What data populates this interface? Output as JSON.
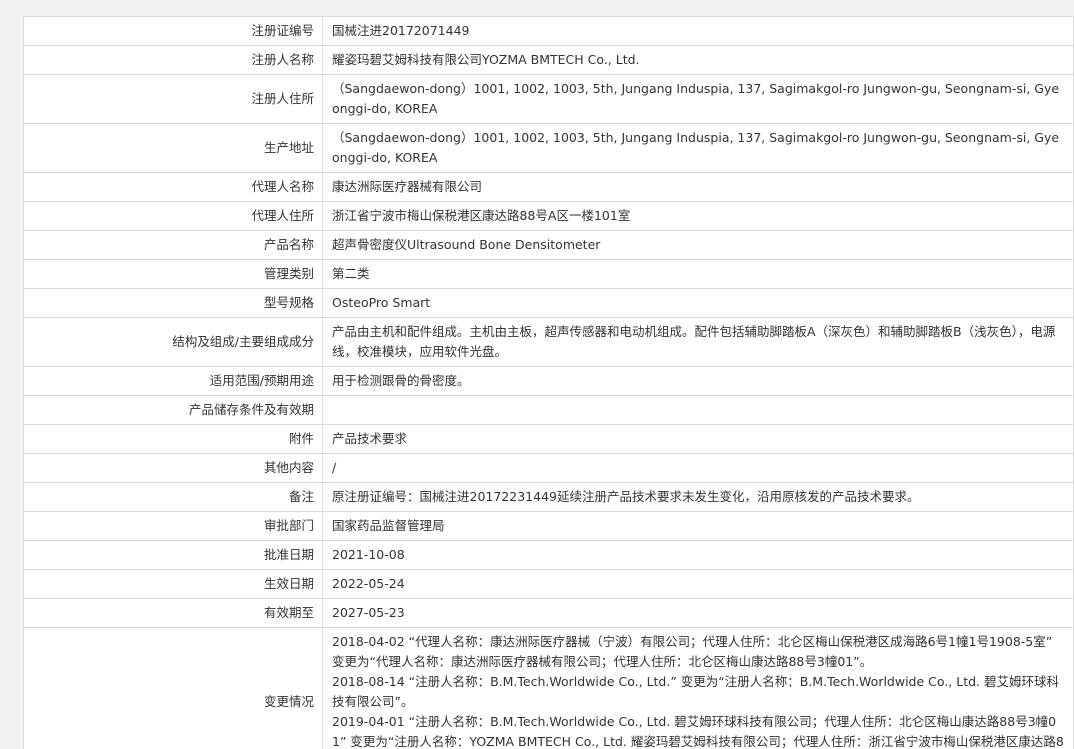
{
  "record": {
    "rows": [
      {
        "label": "注册证编号",
        "value": "国械注进20172071449"
      },
      {
        "label": "注册人名称",
        "value": "耀姿玛碧艾姆科技有限公司YOZMA BMTECH Co., Ltd."
      },
      {
        "label": "注册人住所",
        "value": "（Sangdaewon-dong）1001, 1002, 1003, 5th, Jungang Induspia, 137, Sagimakgol-ro Jungwon-gu, Seongnam-si, Gyeonggi-do, KOREA"
      },
      {
        "label": "生产地址",
        "value": "（Sangdaewon-dong）1001, 1002, 1003, 5th, Jungang Induspia, 137, Sagimakgol-ro Jungwon-gu, Seongnam-si, Gyeonggi-do, KOREA"
      },
      {
        "label": "代理人名称",
        "value": "康达洲际医疗器械有限公司"
      },
      {
        "label": "代理人住所",
        "value": "浙江省宁波市梅山保税港区康达路88号A区一楼101室"
      },
      {
        "label": "产品名称",
        "value": "超声骨密度仪Ultrasound Bone Densitometer"
      },
      {
        "label": "管理类别",
        "value": "第二类"
      },
      {
        "label": "型号规格",
        "value": "OsteoPro Smart"
      },
      {
        "label": "结构及组成/主要组成成分",
        "value": "产品由主机和配件组成。主机由主板，超声传感器和电动机组成。配件包括辅助脚踏板A（深灰色）和辅助脚踏板B（浅灰色），电源线，校准模块，应用软件光盘。"
      },
      {
        "label": "适用范围/预期用途",
        "value": "用于检测跟骨的骨密度。"
      },
      {
        "label": "产品储存条件及有效期",
        "value": ""
      },
      {
        "label": "附件",
        "value": "产品技术要求"
      },
      {
        "label": "其他内容",
        "value": "/"
      },
      {
        "label": "备注",
        "value": "原注册证编号：国械注进20172231449延续注册产品技术要求未发生变化，沿用原核发的产品技术要求。"
      },
      {
        "label": "审批部门",
        "value": "国家药品监督管理局"
      },
      {
        "label": "批准日期",
        "value": "2021-10-08"
      },
      {
        "label": "生效日期",
        "value": "2022-05-24"
      },
      {
        "label": "有效期至",
        "value": "2027-05-23"
      }
    ],
    "history": {
      "label": "变更情况",
      "lines": [
        "2018-04-02 “代理人名称：康达洲际医疗器械（宁波）有限公司；代理人住所：北仑区梅山保税港区成海路6号1幢1号1908-5室” 变更为“代理人名称：康达洲际医疗器械有限公司；代理人住所：北仑区梅山康达路88号3幢01”。",
        "2018-08-14 “注册人名称：B.M.Tech.Worldwide Co., Ltd.” 变更为“注册人名称：B.M.Tech.Worldwide Co., Ltd. 碧艾姆环球科技有限公司”。",
        "2019-04-01 “注册人名称：B.M.Tech.Worldwide Co., Ltd. 碧艾姆环球科技有限公司；代理人住所：北仑区梅山康达路88号3幢01” 变更为“注册人名称：YOZMA BMTECH Co., Ltd. 耀姿玛碧艾姆科技有限公司；代理人住所：浙江省宁波市梅山保税港区康达路88号"
      ]
    }
  }
}
